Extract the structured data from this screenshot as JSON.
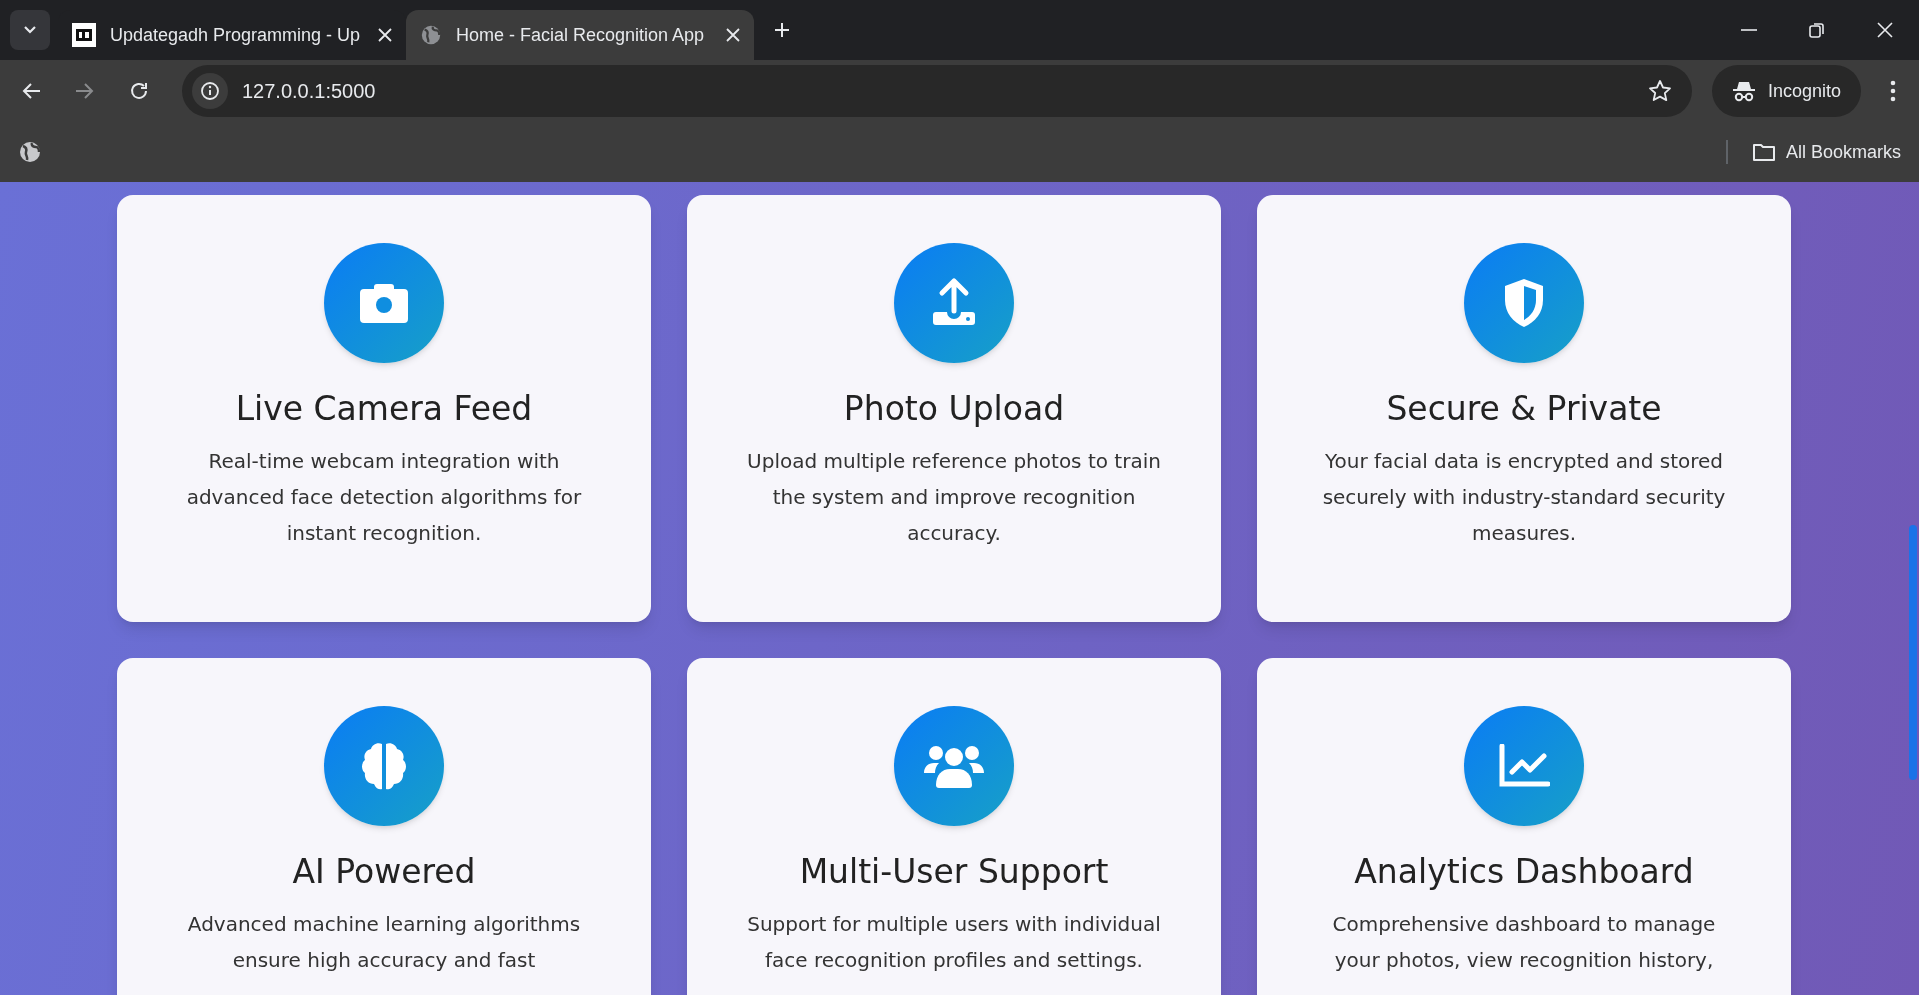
{
  "browser": {
    "tabs": [
      {
        "title": "Updategadh Programming - Up",
        "kind": "logo",
        "selected": false
      },
      {
        "title": "Home - Facial Recognition App",
        "kind": "globe",
        "selected": true
      }
    ],
    "address": "127.0.0.1:5000",
    "profile": "Incognito",
    "bookmarks_label": "All Bookmarks"
  },
  "features": [
    {
      "kind": "camera",
      "title": "Live Camera Feed",
      "description": "Real-time webcam integration with advanced face detection algorithms for instant recognition."
    },
    {
      "kind": "upload",
      "title": "Photo Upload",
      "description": "Upload multiple reference photos to train the system and improve recognition accuracy."
    },
    {
      "kind": "shield",
      "title": "Secure & Private",
      "description": "Your facial data is encrypted and stored securely with industry-standard security measures."
    },
    {
      "kind": "brain",
      "title": "AI Powered",
      "description": "Advanced machine learning algorithms ensure high accuracy and fast"
    },
    {
      "kind": "users",
      "title": "Multi-User Support",
      "description": "Support for multiple users with individual face recognition profiles and settings."
    },
    {
      "kind": "chart",
      "title": "Analytics Dashboard",
      "description": "Comprehensive dashboard to manage your photos, view recognition history,"
    }
  ]
}
